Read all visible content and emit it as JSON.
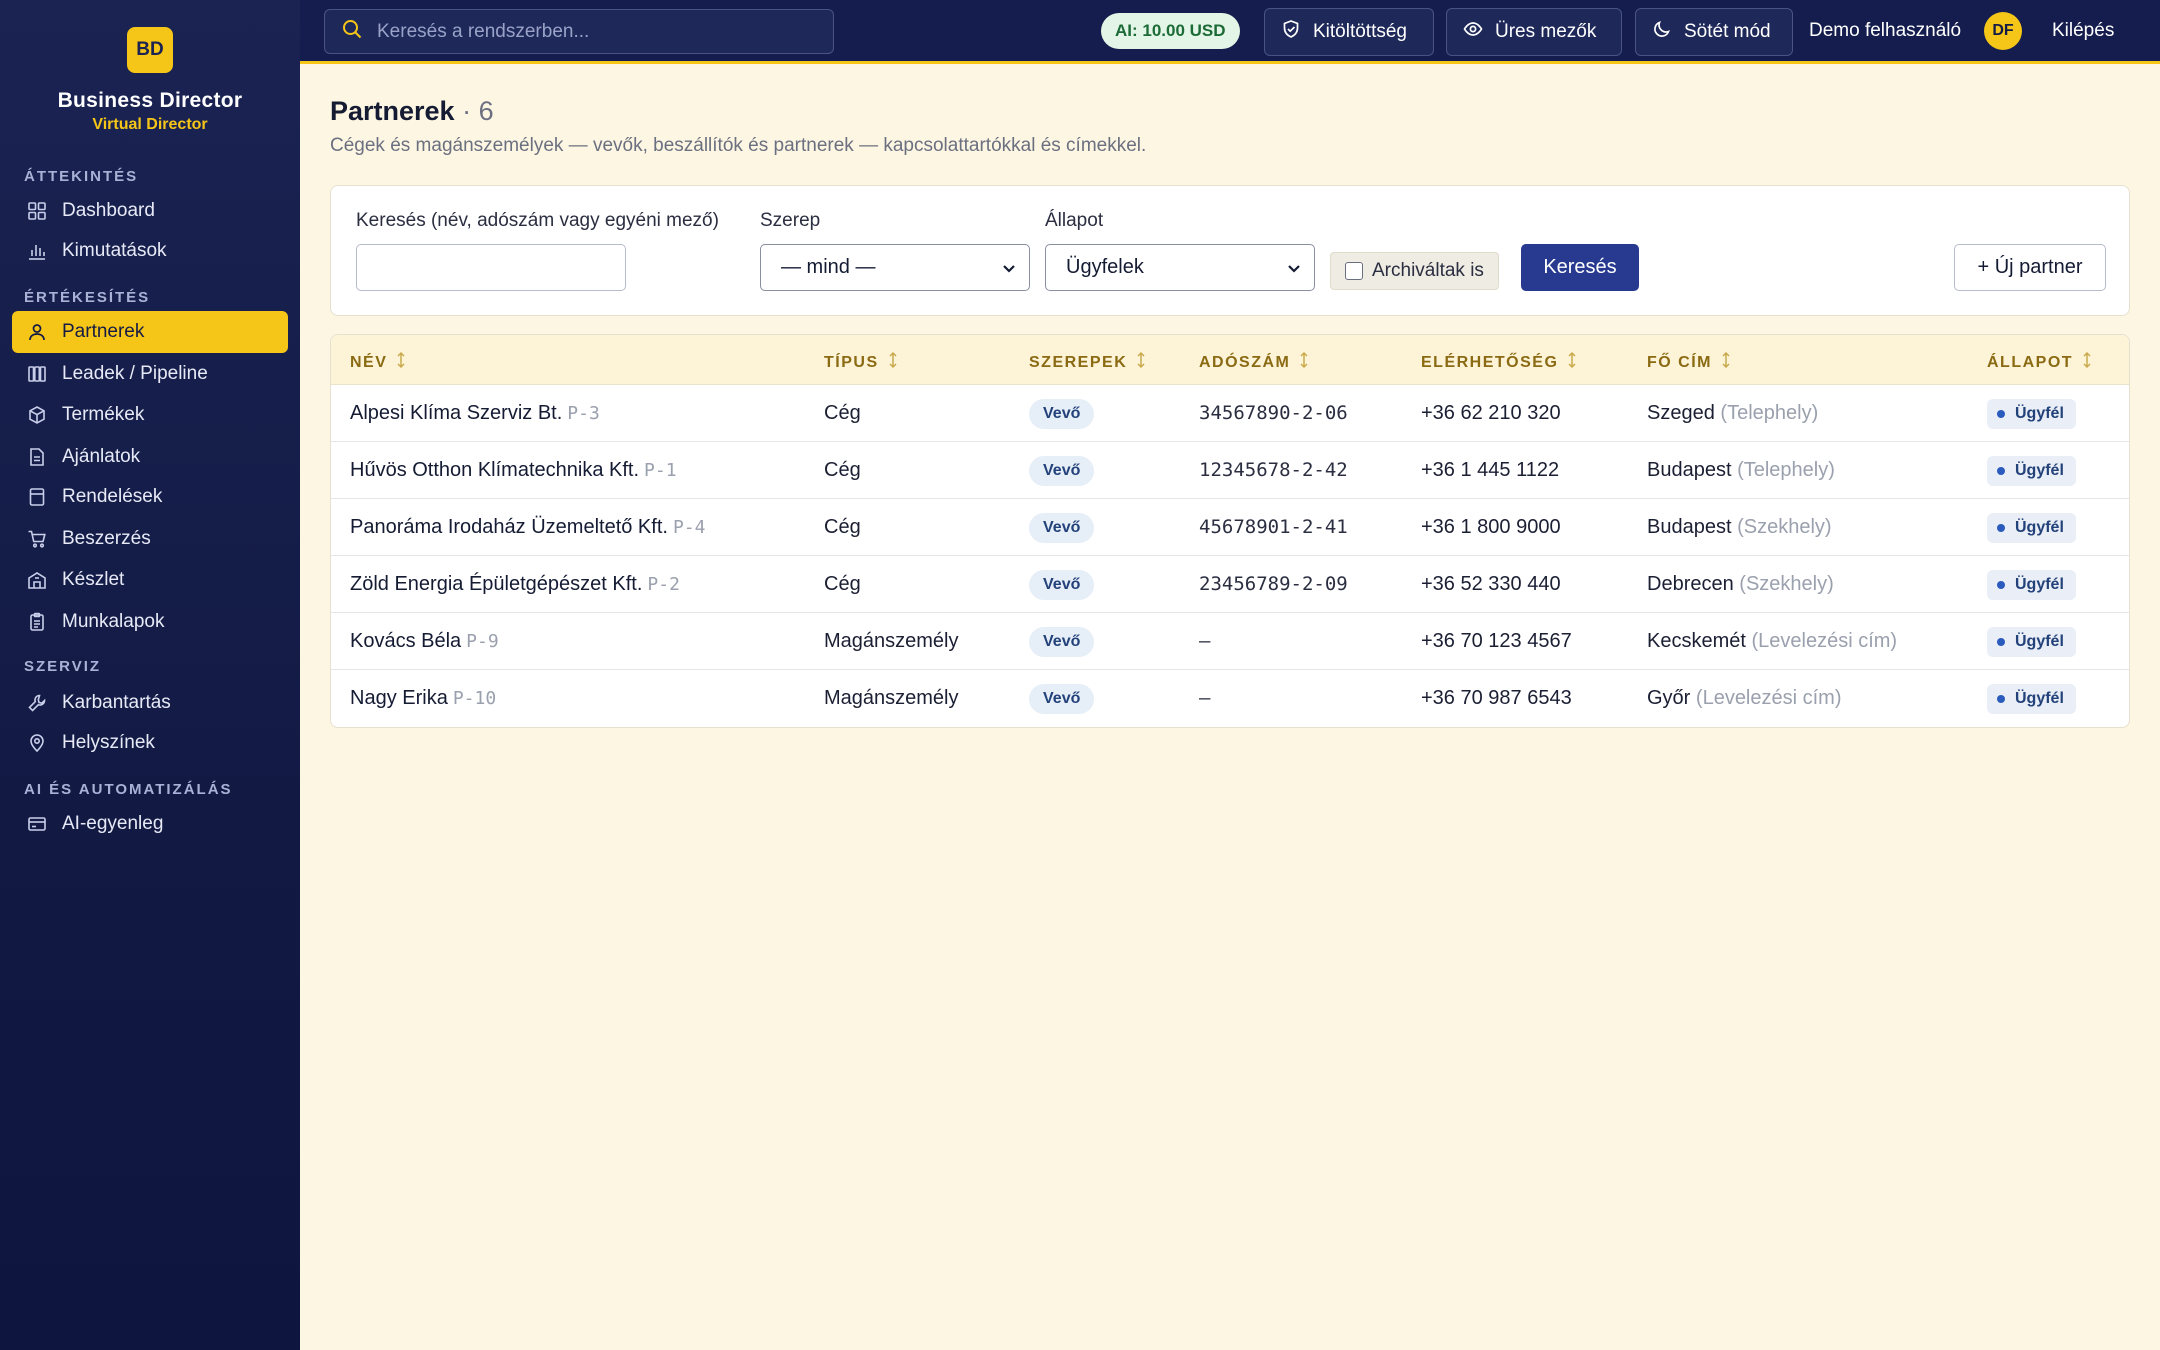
{
  "brand": {
    "logo": "BD",
    "title": "Business Director",
    "subtitle": "Virtual Director"
  },
  "sidebar": {
    "sections": [
      {
        "label": "ÁTTEKINTÉS"
      },
      {
        "label": "ÉRTÉKESÍTÉS"
      },
      {
        "label": "SZERVIZ"
      },
      {
        "label": "AI ÉS AUTOMATIZÁLÁS"
      }
    ],
    "items": [
      {
        "label": "Dashboard",
        "icon": "grid-icon"
      },
      {
        "label": "Kimutatások",
        "icon": "bar-chart-icon"
      },
      {
        "label": "Partnerek",
        "icon": "user-icon",
        "active": true
      },
      {
        "label": "Leadek / Pipeline",
        "icon": "kanban-icon"
      },
      {
        "label": "Termékek",
        "icon": "box-icon"
      },
      {
        "label": "Ajánlatok",
        "icon": "document-icon"
      },
      {
        "label": "Rendelések",
        "icon": "receipt-icon"
      },
      {
        "label": "Beszerzés",
        "icon": "cart-icon"
      },
      {
        "label": "Készlet",
        "icon": "warehouse-icon"
      },
      {
        "label": "Munkalapok",
        "icon": "clipboard-icon"
      },
      {
        "label": "Karbantartás",
        "icon": "wrench-icon"
      },
      {
        "label": "Helyszínek",
        "icon": "map-pin-icon"
      },
      {
        "label": "AI-egyenleg",
        "icon": "credit-card-icon"
      }
    ]
  },
  "topbar": {
    "search_placeholder": "Keresés a rendszerben...",
    "ai_balance": "AI: 10.00 USD",
    "btn_completeness": "Kitöltöttség",
    "btn_empty_fields": "Üres mezők",
    "btn_dark_mode": "Sötét mód",
    "user_name": "Demo felhasználó",
    "avatar": "DF",
    "logout": "Kilépés"
  },
  "page": {
    "title": "Partnerek",
    "count": "· 6",
    "description": "Cégek és magánszemélyek — vevők, beszállítók és partnerek — kapcsolattartókkal és címekkel."
  },
  "filters": {
    "search_label": "Keresés (név, adószám vagy egyéni mező)",
    "search_value": "",
    "role_label": "Szerep",
    "role_value": "— mind —",
    "status_label": "Állapot",
    "status_value": "Ügyfelek",
    "archived_label": "Archiváltak is",
    "archived_checked": false,
    "search_button": "Keresés",
    "new_button": "+ Új partner"
  },
  "table": {
    "columns": [
      "NÉV",
      "TÍPUS",
      "SZEREPEK",
      "ADÓSZÁM",
      "ELÉRHETŐSÉG",
      "FŐ CÍM",
      "ÁLLAPOT"
    ],
    "rows": [
      {
        "name": "Alpesi Klíma Szerviz Bt.",
        "code": "P-3",
        "type": "Cég",
        "role": "Vevő",
        "tax": "34567890-2-06",
        "phone": "+36 62 210 320",
        "city": "Szeged",
        "addr_type": "(Telephely)",
        "status": "Ügyfél"
      },
      {
        "name": "Hűvös Otthon Klímatechnika Kft.",
        "code": "P-1",
        "type": "Cég",
        "role": "Vevő",
        "tax": "12345678-2-42",
        "phone": "+36 1 445 1122",
        "city": "Budapest",
        "addr_type": "(Telephely)",
        "status": "Ügyfél"
      },
      {
        "name": "Panoráma Irodaház Üzemeltető Kft.",
        "code": "P-4",
        "type": "Cég",
        "role": "Vevő",
        "tax": "45678901-2-41",
        "phone": "+36 1 800 9000",
        "city": "Budapest",
        "addr_type": "(Szekhely)",
        "status": "Ügyfél"
      },
      {
        "name": "Zöld Energia Épületgépészet Kft.",
        "code": "P-2",
        "type": "Cég",
        "role": "Vevő",
        "tax": "23456789-2-09",
        "phone": "+36 52 330 440",
        "city": "Debrecen",
        "addr_type": "(Szekhely)",
        "status": "Ügyfél"
      },
      {
        "name": "Kovács Béla",
        "code": "P-9",
        "type": "Magánszemély",
        "role": "Vevő",
        "tax": "—",
        "phone": "+36 70 123 4567",
        "city": "Kecskemét",
        "addr_type": "(Levelezési cím)",
        "status": "Ügyfél"
      },
      {
        "name": "Nagy Erika",
        "code": "P-10",
        "type": "Magánszemély",
        "role": "Vevő",
        "tax": "—",
        "phone": "+36 70 987 6543",
        "city": "Győr",
        "addr_type": "(Levelezési cím)",
        "status": "Ügyfél"
      }
    ]
  },
  "colors": {
    "accent": "#f5c518",
    "sidebar": "#141d4d",
    "primary_button": "#273a8f",
    "background": "#fdf6e3"
  }
}
